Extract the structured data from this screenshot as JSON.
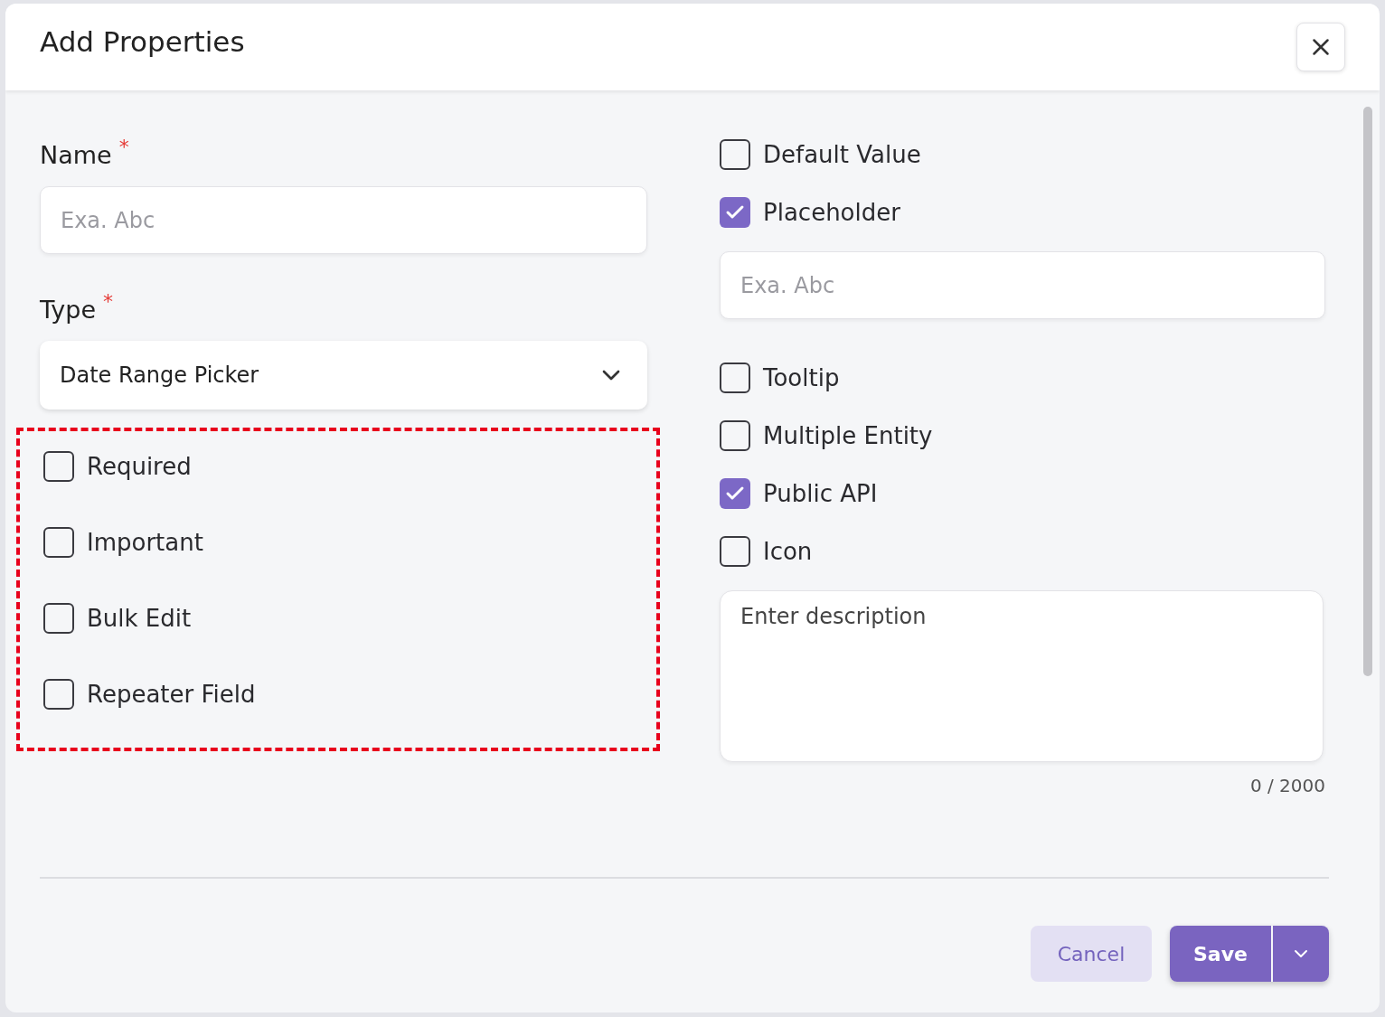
{
  "dialog": {
    "title": "Add Properties"
  },
  "name_field": {
    "label": "Name",
    "required_mark": "*",
    "placeholder": "Exa. Abc"
  },
  "type_field": {
    "label": "Type",
    "required_mark": "*",
    "value": "Date Range Picker"
  },
  "left_options": [
    {
      "label": "Required",
      "checked": false
    },
    {
      "label": "Important",
      "checked": false
    },
    {
      "label": "Bulk Edit",
      "checked": false
    },
    {
      "label": "Repeater Field",
      "checked": false
    }
  ],
  "right_options": [
    {
      "kind": "checkbox",
      "label": "Default Value",
      "checked": false
    },
    {
      "kind": "checkbox",
      "label": "Placeholder",
      "checked": true
    },
    {
      "kind": "input",
      "placeholder": "Exa. Abc"
    },
    {
      "kind": "checkbox",
      "label": "Tooltip",
      "checked": false
    },
    {
      "kind": "checkbox",
      "label": "Multiple Entity",
      "checked": false
    },
    {
      "kind": "checkbox",
      "label": "Public API",
      "checked": true
    },
    {
      "kind": "checkbox",
      "label": "Icon",
      "checked": false
    }
  ],
  "description": {
    "placeholder": "Enter description",
    "counter": "0 / 2000"
  },
  "footer": {
    "cancel": "Cancel",
    "save": "Save"
  }
}
